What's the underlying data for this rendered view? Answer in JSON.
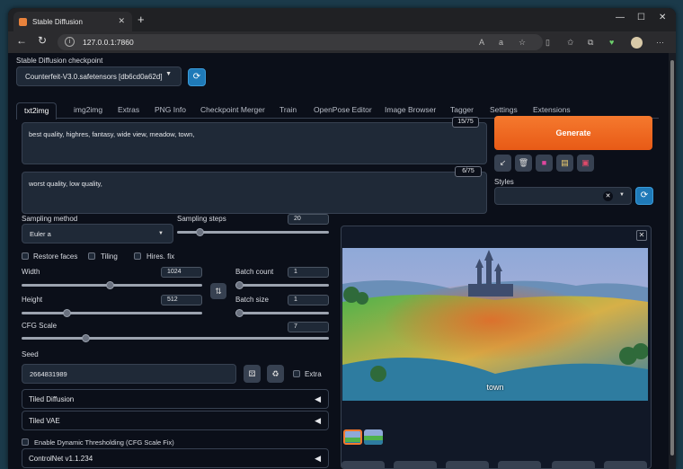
{
  "browser": {
    "tab_title": "Stable Diffusion",
    "url": "127.0.0.1:7860",
    "new_tab_symbol": "+",
    "close_symbol": "✕",
    "minimize_symbol": "—",
    "maximize_symbol": "☐"
  },
  "checkpoint": {
    "label": "Stable Diffusion checkpoint",
    "value": "Counterfeit-V3.0.safetensors [db6cd0a62d]"
  },
  "tabs": [
    "txt2img",
    "img2img",
    "Extras",
    "PNG Info",
    "Checkpoint Merger",
    "Train",
    "OpenPose Editor",
    "Image Browser",
    "Tagger",
    "Settings",
    "Extensions"
  ],
  "prompt": {
    "positive": "best quality, highres, fantasy, wide view, meadow, town,",
    "positive_count": "15/75",
    "negative": "worst quality, low quality,",
    "negative_count": "6/75"
  },
  "generate_label": "Generate",
  "styles_label": "Styles",
  "sampling": {
    "method_label": "Sampling method",
    "method_value": "Euler a",
    "steps_label": "Sampling steps",
    "steps_value": "20",
    "steps_fraction": 0.13
  },
  "checkboxes": {
    "restore_faces": "Restore faces",
    "tiling": "Tiling",
    "hires_fix": "Hires. fix"
  },
  "width": {
    "label": "Width",
    "value": "1024",
    "fraction": 0.49
  },
  "height": {
    "label": "Height",
    "value": "512",
    "fraction": 0.24
  },
  "batch_count": {
    "label": "Batch count",
    "value": "1",
    "fraction": 0
  },
  "batch_size": {
    "label": "Batch size",
    "value": "1",
    "fraction": 0
  },
  "cfg": {
    "label": "CFG Scale",
    "value": "7",
    "fraction": 0.2
  },
  "seed": {
    "label": "Seed",
    "value": "2664831989",
    "extra_label": "Extra"
  },
  "accordions": {
    "tiled_diffusion": "Tiled Diffusion",
    "tiled_vae": "Tiled VAE",
    "dynamic_thresholding": "Enable Dynamic Thresholding (CFG Scale Fix)",
    "controlnet": "ControlNet v1.1.234"
  },
  "gallery": {
    "caption": "town"
  },
  "colors": {
    "accent_orange": "#f5792e",
    "accent_blue": "#1f7ab8",
    "background": "#0b0f19"
  }
}
